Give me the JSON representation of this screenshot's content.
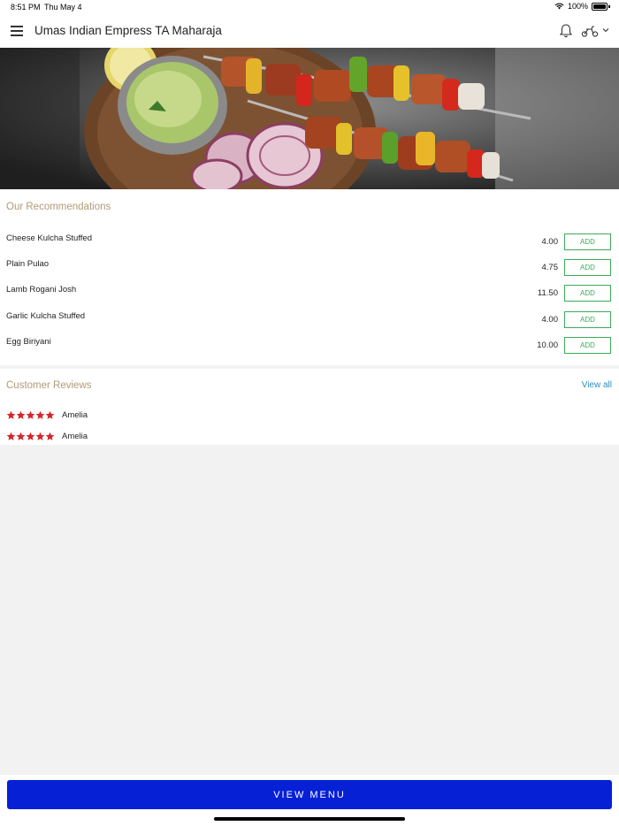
{
  "status": {
    "time": "8:51 PM",
    "date": "Thu May 4",
    "battery": "100%"
  },
  "header": {
    "title": "Umas Indian Empress TA Maharaja",
    "icons": [
      "menu-icon",
      "bell-icon",
      "scooter-icon",
      "chevron-down-icon"
    ]
  },
  "recommendations": {
    "title": "Our Recommendations",
    "add_label": "ADD",
    "items": [
      {
        "name": "Cheese Kulcha Stuffed",
        "price": "4.00"
      },
      {
        "name": "Plain Pulao",
        "price": "4.75"
      },
      {
        "name": "Lamb Rogani Josh",
        "price": "11.50"
      },
      {
        "name": "Garlic Kulcha Stuffed",
        "price": "4.00"
      },
      {
        "name": "Egg Biriyani",
        "price": "10.00"
      }
    ]
  },
  "reviews": {
    "title": "Customer Reviews",
    "view_all": "View all",
    "items": [
      {
        "name": "Amelia",
        "rating": 5
      },
      {
        "name": "Amelia",
        "rating": 5
      }
    ]
  },
  "footer": {
    "view_menu": "VIEW MENU"
  },
  "colors": {
    "accent": "#0620d6",
    "add_green": "#3cab59",
    "section_title": "#b19a76",
    "link": "#2a8fc0",
    "star": "#d6262c"
  }
}
